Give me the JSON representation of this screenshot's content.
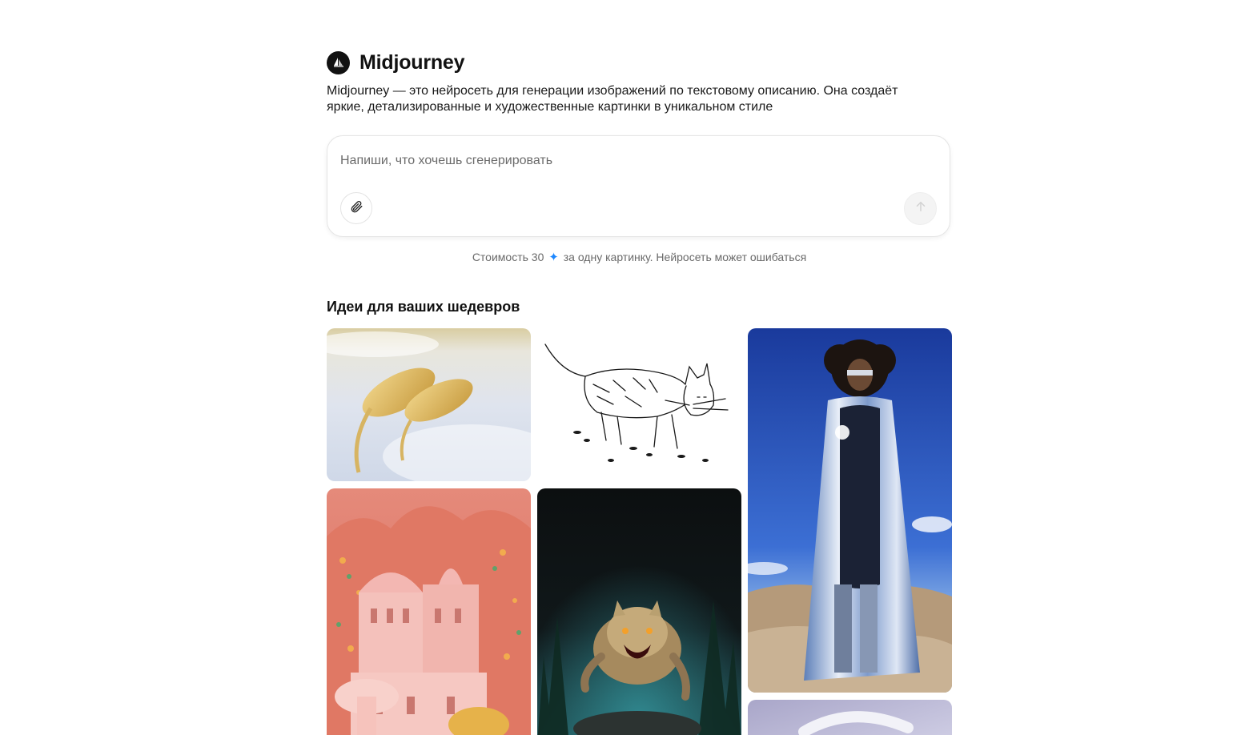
{
  "app": {
    "title": "Midjourney",
    "logo_icon": "sailboat-icon",
    "description": "Midjourney — это нейросеть для генерации изображений по текстовому описанию. Она создаёт яркие, детализированные и художественные картинки в уникальном стиле"
  },
  "prompt": {
    "placeholder": "Напиши, что хочешь сгенерировать",
    "value": "",
    "attach_icon": "paperclip-icon",
    "send_icon": "arrow-up-icon"
  },
  "cost": {
    "prefix": "Стоимость 30",
    "icon": "sparkle-star-icon",
    "suffix": "за одну картинку. Нейросеть может ошибаться",
    "accent_color": "#1e88ff"
  },
  "ideas": {
    "section_title": "Идеи для ваших шедевров",
    "cards": [
      {
        "subject": "golden-fish-image"
      },
      {
        "subject": "sketched-cat-image"
      },
      {
        "subject": "silver-cloak-figure-image"
      },
      {
        "subject": "pink-flower-castle-image"
      },
      {
        "subject": "werewolf-creature-image"
      },
      {
        "subject": "lavender-abstract-image"
      }
    ]
  }
}
